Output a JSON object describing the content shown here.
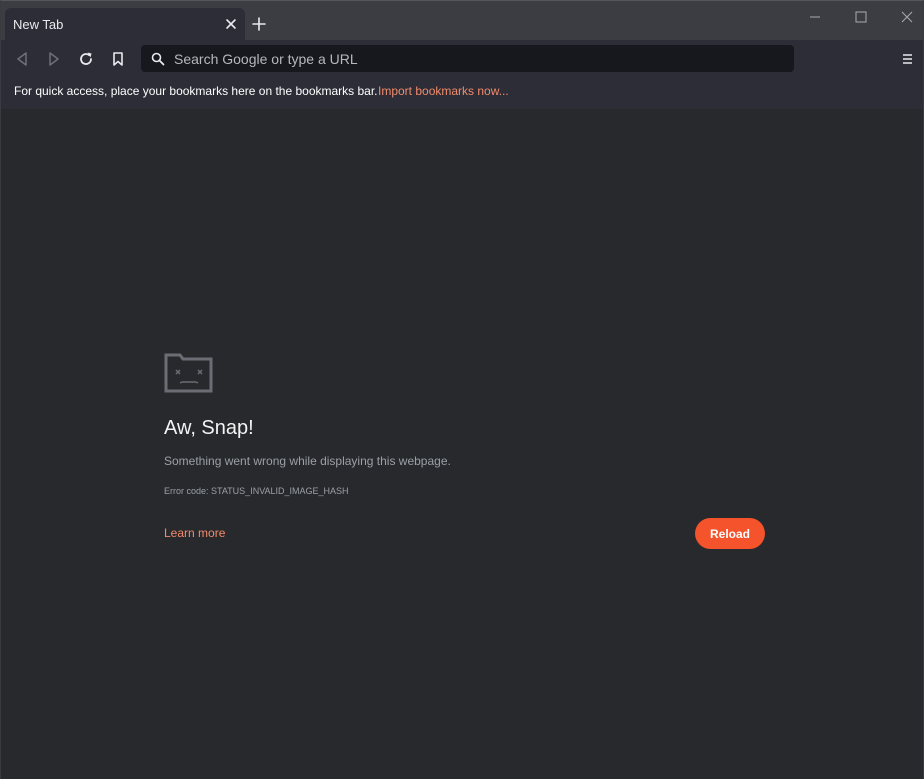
{
  "tabs": [
    {
      "title": "New Tab",
      "active": true
    }
  ],
  "window_controls": [
    "minimize-icon",
    "maximize-icon",
    "close-icon"
  ],
  "toolbar": {
    "icons": [
      "back-icon",
      "forward-icon",
      "reload-icon",
      "bookmark-icon",
      "menu-icon"
    ],
    "search_placeholder": "Search Google or type a URL"
  },
  "bookmarks_bar": {
    "message": "For quick access, place your bookmarks here on the bookmarks bar.",
    "import_link": "Import bookmarks now..."
  },
  "error_page": {
    "icon": "sad-tab-icon",
    "title": "Aw, Snap!",
    "message": "Something went wrong while displaying this webpage.",
    "error_code": "Error code: STATUS_INVALID_IMAGE_HASH",
    "learn_more": "Learn more",
    "reload_label": "Reload"
  },
  "colors": {
    "background": "#28292d",
    "toolbar": "#2c2d36",
    "tabstrip": "#3c3d43",
    "accent_link": "#f28b6c",
    "reload_button": "#f4532c"
  }
}
